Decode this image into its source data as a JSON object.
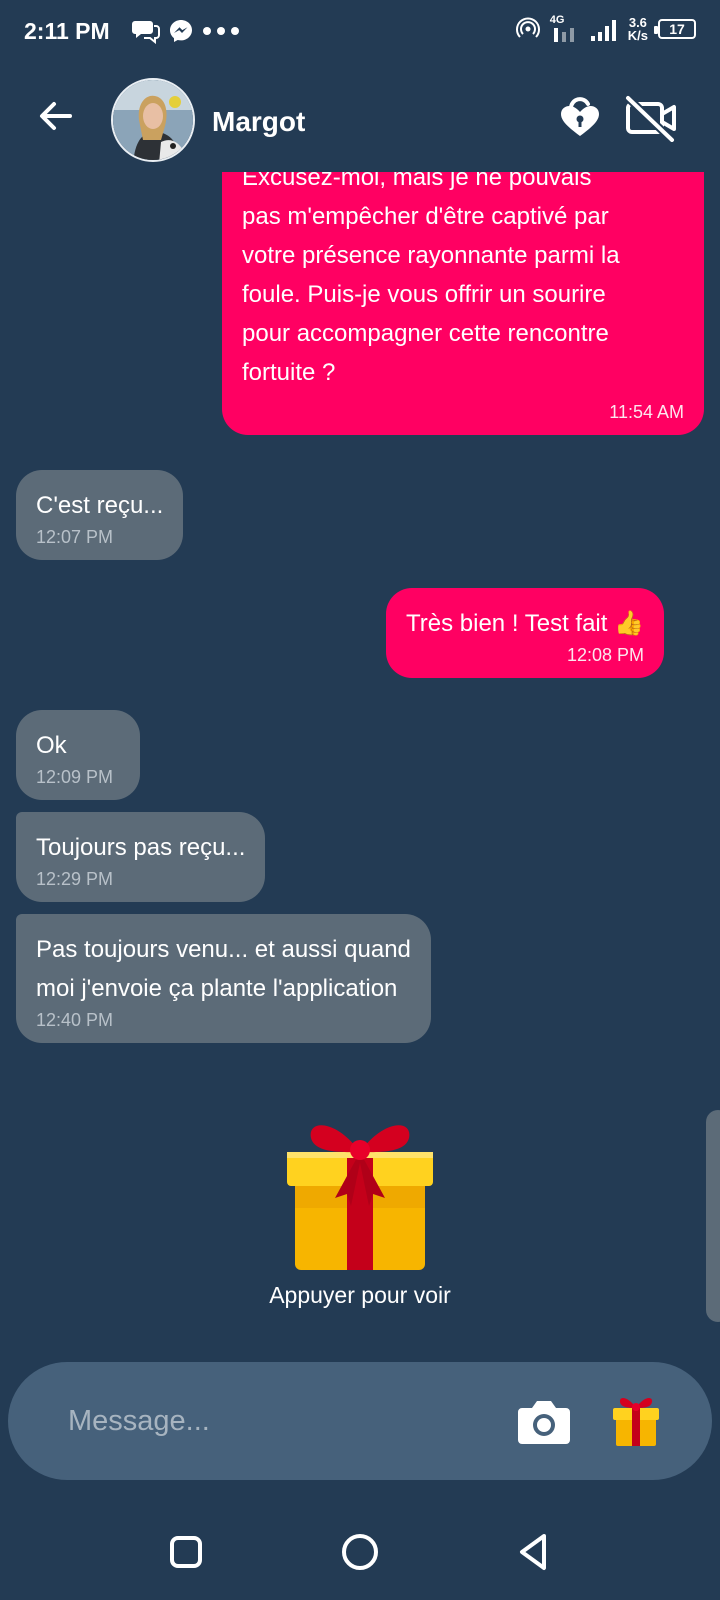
{
  "status_bar": {
    "time": "2:11 PM",
    "net_speed_value": "3.6",
    "net_speed_unit": "K/s",
    "network_type": "4G",
    "battery": "17"
  },
  "header": {
    "contact_name": "Margot"
  },
  "messages": [
    {
      "direction": "out",
      "text": "Excusez-moi, mais je ne pouvais\npas m'empêcher d'être captivé par\nvotre présence rayonnante parmi la\nfoule. Puis-je vous offrir un sourire\npour accompagner cette rencontre\nfortuite ?",
      "time": "11:54 AM"
    },
    {
      "direction": "in",
      "text": "C'est reçu...",
      "time": "12:07 PM"
    },
    {
      "direction": "out",
      "text": "Très bien ! Test fait 👍",
      "time": "12:08 PM"
    },
    {
      "direction": "in",
      "text": "Ok",
      "time": "12:09 PM"
    },
    {
      "direction": "in",
      "text": "Toujours pas reçu...",
      "time": "12:29 PM"
    },
    {
      "direction": "in",
      "text": "Pas toujours venu... et aussi quand\nmoi j'envoie ça plante l'application",
      "time": "12:40 PM"
    }
  ],
  "gift": {
    "caption": "Appuyer pour voir"
  },
  "composer": {
    "placeholder": "Message..."
  },
  "colors": {
    "background": "#233b54",
    "outgoing_bubble": "#ff0062",
    "incoming_bubble": "#5c6b78",
    "composer": "#46617b"
  },
  "icons": {
    "back": "arrow-left-icon",
    "lock": "heart-lock-icon",
    "video": "video-off-icon",
    "camera": "camera-icon",
    "gift": "gift-icon"
  }
}
